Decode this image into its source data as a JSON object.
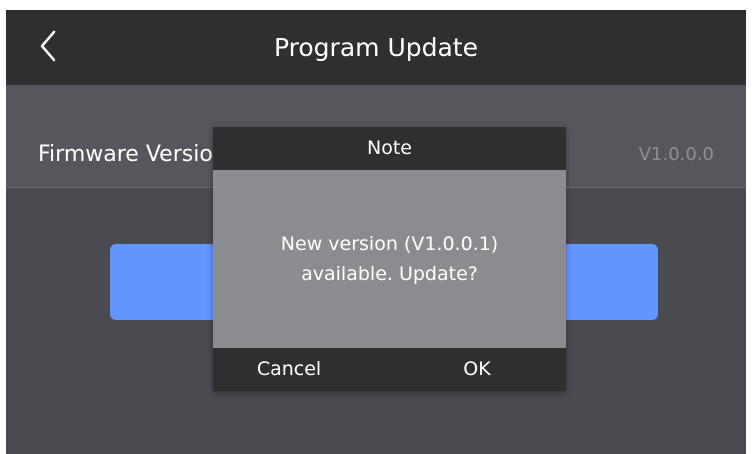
{
  "header": {
    "title": "Program Update",
    "back_icon": "chevron-left-icon"
  },
  "firmware": {
    "label": "Firmware Version",
    "value": "V1.0.0.0"
  },
  "dialog": {
    "title": "Note",
    "message": "New version (V1.0.0.1) available. Update?",
    "cancel_label": "Cancel",
    "ok_label": "OK"
  },
  "colors": {
    "background": "#4a4b50",
    "header": "#2f2f31",
    "accent": "#6495ff",
    "dialog_body": "#8b8c90"
  }
}
